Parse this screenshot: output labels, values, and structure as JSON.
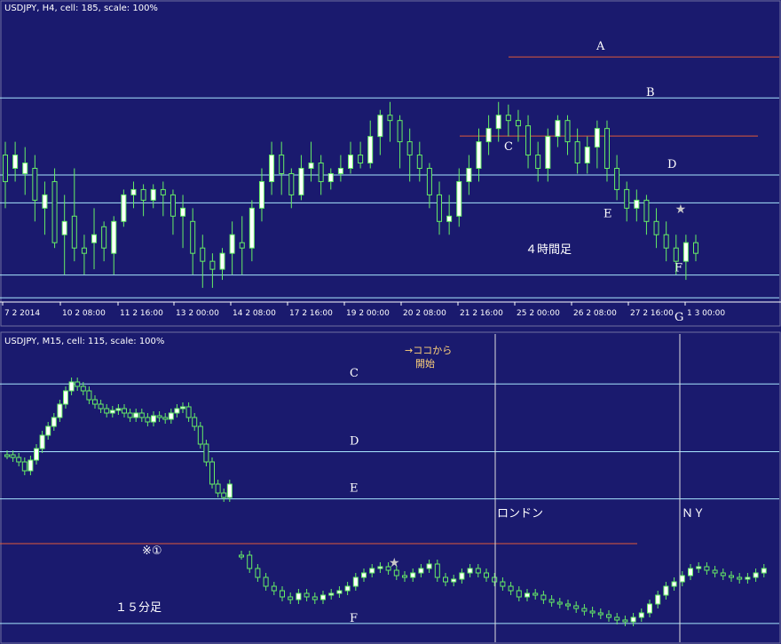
{
  "colors": {
    "background": "#1a1a6e",
    "level_line": "#a8e6ff",
    "red_line": "#e05a3a",
    "candle": "#66ee66",
    "text": "#ffffff",
    "orange_note": "#ffd27a",
    "star": "#c8c8c8"
  },
  "chart_data": [
    {
      "type": "candlestick",
      "title": "USDJPY, H4, cell: 185, scale: 100%",
      "timeframe_note": "４時間足",
      "x_ticks": [
        "7 2 2014",
        "10 2 08:00",
        "11 2 16:00",
        "13 2 00:00",
        "14 2 08:00",
        "17 2 16:00",
        "19 2 00:00",
        "20 2 08:00",
        "21 2 16:00",
        "25 2 00:00",
        "26 2 08:00",
        "27 2 16:00",
        "1 3 00:00"
      ],
      "horizontal_levels": [
        {
          "label": "A",
          "kind": "red",
          "rel": 0.138
        },
        {
          "label": "B",
          "kind": "line",
          "rel": 0.282
        },
        {
          "label": "C",
          "kind": "red",
          "rel": 0.416
        },
        {
          "label": "D",
          "kind": "line",
          "rel": 0.553
        },
        {
          "label": "E",
          "kind": "line",
          "rel": 0.651
        },
        {
          "label": "F",
          "kind": "line",
          "rel": 0.905
        },
        {
          "label": "G",
          "kind": "line",
          "rel": 0.985
        }
      ],
      "marker": {
        "symbol": "★",
        "bar": 67
      },
      "candles": [
        [
          0.55,
          0.45,
          0.6,
          0.35
        ],
        [
          0.5,
          0.55,
          0.6,
          0.45
        ],
        [
          0.48,
          0.52,
          0.58,
          0.4
        ],
        [
          0.5,
          0.38,
          0.55,
          0.3
        ],
        [
          0.35,
          0.4,
          0.45,
          0.25
        ],
        [
          0.45,
          0.22,
          0.5,
          0.2
        ],
        [
          0.25,
          0.3,
          0.4,
          0.1
        ],
        [
          0.32,
          0.2,
          0.5,
          0.15
        ],
        [
          0.2,
          0.18,
          0.25,
          0.1
        ],
        [
          0.22,
          0.25,
          0.35,
          0.12
        ],
        [
          0.28,
          0.2,
          0.3,
          0.15
        ],
        [
          0.18,
          0.3,
          0.32,
          0.1
        ],
        [
          0.3,
          0.4,
          0.42,
          0.28
        ],
        [
          0.4,
          0.42,
          0.45,
          0.35
        ],
        [
          0.42,
          0.38,
          0.44,
          0.32
        ],
        [
          0.38,
          0.42,
          0.44,
          0.35
        ],
        [
          0.42,
          0.4,
          0.45,
          0.32
        ],
        [
          0.4,
          0.32,
          0.42,
          0.25
        ],
        [
          0.32,
          0.35,
          0.4,
          0.2
        ],
        [
          0.3,
          0.18,
          0.35,
          0.1
        ],
        [
          0.2,
          0.15,
          0.25,
          0.05
        ],
        [
          0.15,
          0.12,
          0.18,
          0.05
        ],
        [
          0.12,
          0.18,
          0.2,
          0.08
        ],
        [
          0.18,
          0.25,
          0.3,
          0.1
        ],
        [
          0.22,
          0.2,
          0.32,
          0.1
        ],
        [
          0.2,
          0.35,
          0.38,
          0.15
        ],
        [
          0.35,
          0.45,
          0.5,
          0.3
        ],
        [
          0.45,
          0.55,
          0.6,
          0.4
        ],
        [
          0.55,
          0.48,
          0.6,
          0.4
        ],
        [
          0.48,
          0.4,
          0.5,
          0.35
        ],
        [
          0.4,
          0.5,
          0.55,
          0.38
        ],
        [
          0.5,
          0.52,
          0.6,
          0.45
        ],
        [
          0.52,
          0.45,
          0.55,
          0.4
        ],
        [
          0.45,
          0.48,
          0.5,
          0.42
        ],
        [
          0.48,
          0.5,
          0.55,
          0.45
        ],
        [
          0.5,
          0.55,
          0.6,
          0.48
        ],
        [
          0.55,
          0.52,
          0.6,
          0.5
        ],
        [
          0.52,
          0.62,
          0.68,
          0.5
        ],
        [
          0.62,
          0.7,
          0.72,
          0.55
        ],
        [
          0.7,
          0.68,
          0.75,
          0.6
        ],
        [
          0.68,
          0.6,
          0.7,
          0.5
        ],
        [
          0.6,
          0.55,
          0.65,
          0.45
        ],
        [
          0.55,
          0.5,
          0.6,
          0.45
        ],
        [
          0.5,
          0.4,
          0.52,
          0.35
        ],
        [
          0.4,
          0.3,
          0.45,
          0.25
        ],
        [
          0.3,
          0.32,
          0.4,
          0.25
        ],
        [
          0.32,
          0.45,
          0.5,
          0.28
        ],
        [
          0.45,
          0.5,
          0.55,
          0.4
        ],
        [
          0.5,
          0.6,
          0.65,
          0.45
        ],
        [
          0.6,
          0.65,
          0.7,
          0.55
        ],
        [
          0.65,
          0.7,
          0.75,
          0.6
        ],
        [
          0.7,
          0.68,
          0.74,
          0.62
        ],
        [
          0.68,
          0.66,
          0.72,
          0.6
        ],
        [
          0.66,
          0.55,
          0.7,
          0.5
        ],
        [
          0.55,
          0.5,
          0.6,
          0.45
        ],
        [
          0.5,
          0.62,
          0.65,
          0.45
        ],
        [
          0.62,
          0.68,
          0.7,
          0.58
        ],
        [
          0.68,
          0.6,
          0.7,
          0.55
        ],
        [
          0.6,
          0.52,
          0.65,
          0.48
        ],
        [
          0.52,
          0.58,
          0.62,
          0.48
        ],
        [
          0.58,
          0.65,
          0.68,
          0.5
        ],
        [
          0.65,
          0.5,
          0.68,
          0.45
        ],
        [
          0.5,
          0.42,
          0.55,
          0.38
        ],
        [
          0.42,
          0.35,
          0.45,
          0.3
        ],
        [
          0.35,
          0.38,
          0.42,
          0.3
        ],
        [
          0.38,
          0.3,
          0.4,
          0.25
        ],
        [
          0.3,
          0.25,
          0.35,
          0.2
        ],
        [
          0.25,
          0.2,
          0.3,
          0.15
        ],
        [
          0.2,
          0.15,
          0.25,
          0.1
        ],
        [
          0.15,
          0.22,
          0.25,
          0.08
        ],
        [
          0.22,
          0.18,
          0.25,
          0.15
        ]
      ]
    },
    {
      "type": "candlestick",
      "title": "USDJPY, M15, cell: 115, scale: 100%",
      "timeframe_note": "１５分足",
      "annotation": "→ココから\n開始",
      "session_labels": [
        "ロンドン",
        "ＮＹ"
      ],
      "note_symbol": "※①",
      "horizontal_levels": [
        {
          "label": "C",
          "kind": "line",
          "rel": 0.162
        },
        {
          "label": "D",
          "kind": "line",
          "rel": 0.382
        },
        {
          "label": "E",
          "kind": "line",
          "rel": 0.535
        },
        {
          "label": "",
          "kind": "red",
          "rel": 0.68
        },
        {
          "label": "F",
          "kind": "line",
          "rel": 0.939
        }
      ],
      "marker": {
        "symbol": "★",
        "bar": 50
      }
    }
  ]
}
